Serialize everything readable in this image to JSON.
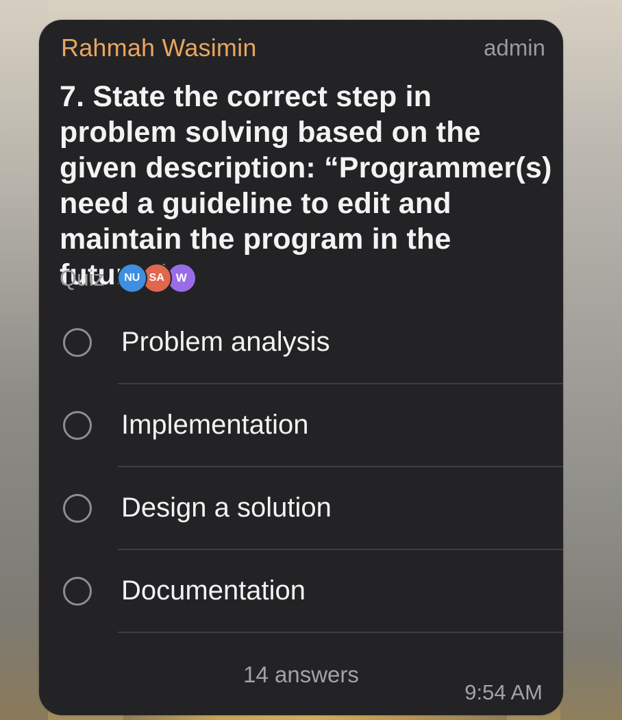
{
  "message": {
    "sender": "Rahmah Wasimin",
    "role": "admin",
    "question": "7. State the correct step in problem solving based on the given description: “Programmer(s) need a guideline to edit and maintain the program in the future.”",
    "type_label": "Quiz",
    "voters": [
      {
        "initials": "NU",
        "color": "#3d8fe0"
      },
      {
        "initials": "SA",
        "color": "#e0664d"
      },
      {
        "initials": "W",
        "color": "#9a6de8"
      }
    ],
    "options": [
      {
        "label": "Problem analysis",
        "selected": false
      },
      {
        "label": "Implementation",
        "selected": false
      },
      {
        "label": "Design a solution",
        "selected": false
      },
      {
        "label": "Documentation",
        "selected": false
      }
    ],
    "answers_count": "14 answers",
    "time": "9:54 AM"
  },
  "colors": {
    "bubble": "#232325",
    "sender": "#e9a560",
    "text": "#f3f3f3",
    "muted": "#9b9b9f"
  },
  "icons": {
    "radio": "radio-unchecked-icon"
  }
}
